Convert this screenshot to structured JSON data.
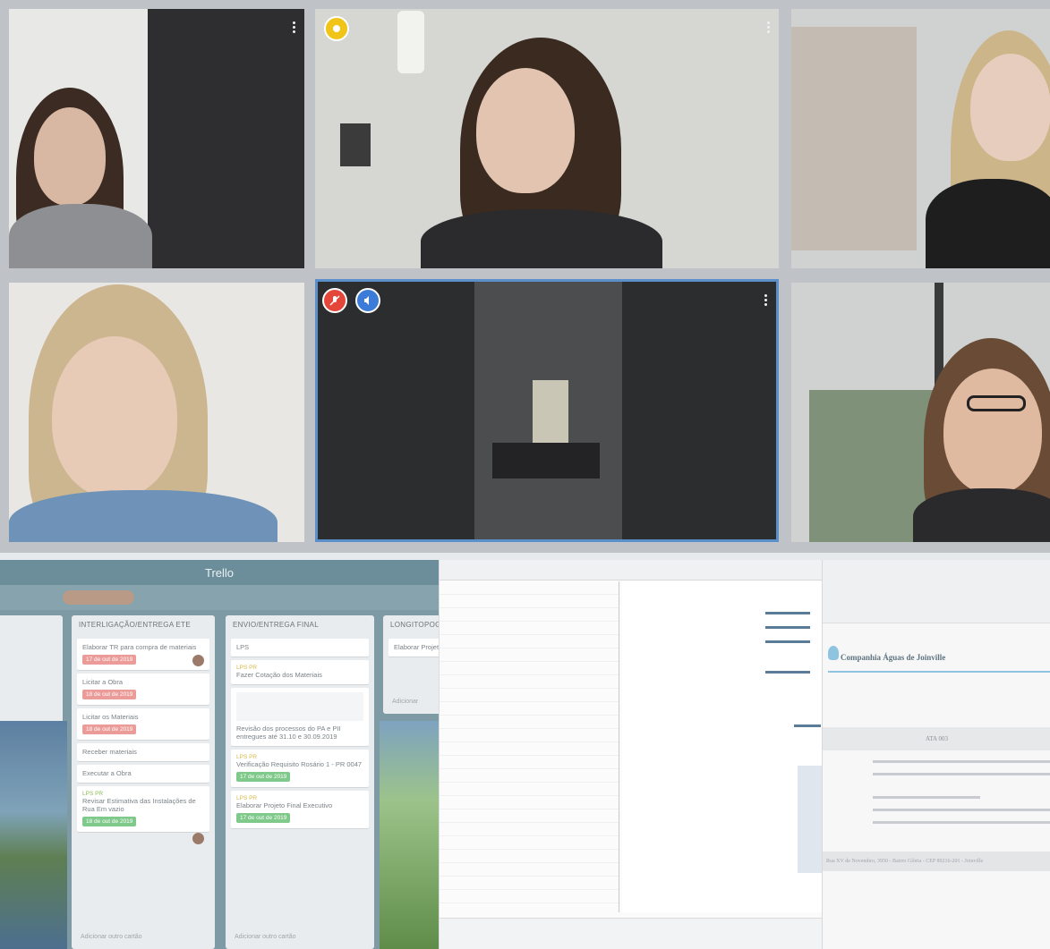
{
  "trello": {
    "app_name": "Trello",
    "lists": [
      {
        "title": "INTERLIGAÇÃO/ENTREGA ETE",
        "cards": [
          {
            "text": "Elaborar TR para compra de materiais",
            "due": "17 de out de 2019"
          },
          {
            "text": "Licitar a Obra",
            "due": "18 de out de 2019"
          },
          {
            "text": "Licitar os Materiais",
            "due": "18 de out de 2019"
          },
          {
            "text": "Receber materiais"
          },
          {
            "text": "Executar a Obra"
          },
          {
            "label": "LPS PR",
            "text": "Revisar Estimativa das Instalações de Rua Em vazio",
            "due": "18 de out de 2019"
          }
        ],
        "add_card": "Adicionar outro cartão"
      },
      {
        "title": "ENVIO/ENTREGA FINAL",
        "cards": [
          {
            "text": "LPS"
          },
          {
            "label": "LPS PR",
            "text": "Fazer Cotação dos Materiais"
          },
          {
            "text": "Revisão dos processos do PA e PII entregues até 31.10 e 30.09.2019"
          },
          {
            "label": "LPS PR",
            "text": "Verificação Requisito Rosário 1 - PR 0047",
            "due": "17 de out de 2019"
          },
          {
            "label": "LPS PR",
            "text": "Elaborar Projeto Final Executivo",
            "due": "17 de out de 2019"
          }
        ],
        "add_card": "Adicionar outro cartão"
      },
      {
        "title": "LONGITOPOGR",
        "cards": [
          {
            "text": "Elaborar Projeto"
          }
        ],
        "add_card": "Adicionar"
      }
    ]
  },
  "document": {
    "company": "Companhia Águas de Joinville",
    "heading": "ATA 003",
    "address": "Rua XV de Novembro, 3950 - Bairro Glória - CEP 89216-201 - Joinville"
  },
  "colors": {
    "red_badge": "#e4473a",
    "blue_badge": "#3d7bd9",
    "yellow_badge": "#f0c419",
    "active_border": "#5b8fc9",
    "trello_bg": "#7e9aa5"
  }
}
